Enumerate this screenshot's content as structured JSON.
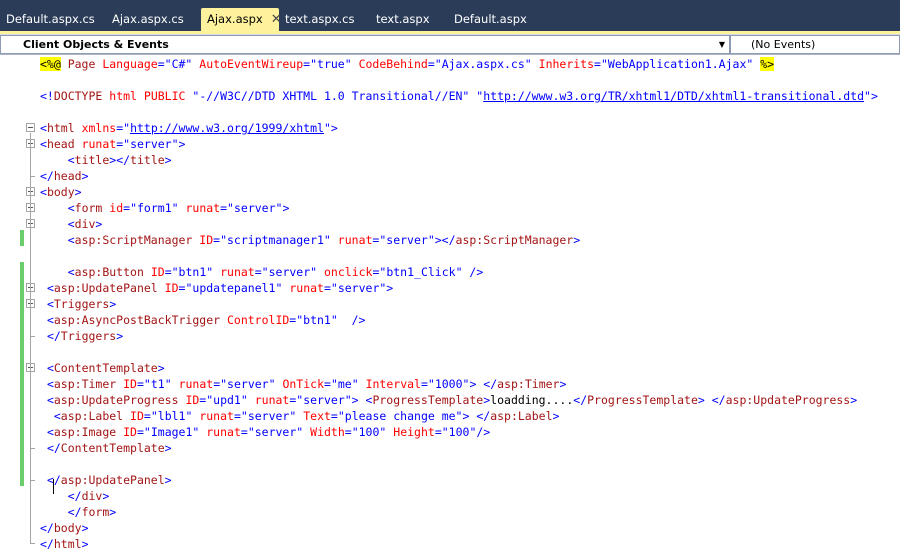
{
  "tabs": [
    {
      "label": "Default.aspx.cs",
      "active": false
    },
    {
      "label": "Ajax.aspx.cs",
      "active": false
    },
    {
      "label": "Ajax.aspx",
      "active": true
    },
    {
      "label": "text.aspx.cs",
      "active": false
    },
    {
      "label": "text.aspx",
      "active": false
    },
    {
      "label": "Default.aspx",
      "active": false
    }
  ],
  "navbar": {
    "objects_combo": "Client Objects & Events",
    "events_combo": "(No Events)"
  },
  "colors": {
    "tab_strip": "#2b3c59",
    "active_tab": "#fff29d",
    "change_bar": "#6ccd6c",
    "keyword": "#0000ff",
    "element": "#a31515",
    "attribute": "#ff0000",
    "directive_highlight": "#ffff00"
  },
  "code_lines": [
    [
      [
        "<%@",
        "hl-dir"
      ],
      [
        " Page ",
        "c-maroon"
      ],
      [
        "Language",
        "c-red"
      ],
      [
        "=",
        "c-blue"
      ],
      [
        "\"C#\"",
        "c-blue"
      ],
      [
        " ",
        ""
      ],
      [
        "AutoEventWireup",
        "c-red"
      ],
      [
        "=",
        "c-blue"
      ],
      [
        "\"true\"",
        "c-blue"
      ],
      [
        " ",
        ""
      ],
      [
        "CodeBehind",
        "c-red"
      ],
      [
        "=",
        "c-blue"
      ],
      [
        "\"Ajax.aspx.cs\"",
        "c-blue"
      ],
      [
        " ",
        ""
      ],
      [
        "Inherits",
        "c-red"
      ],
      [
        "=",
        "c-blue"
      ],
      [
        "\"WebApplication1.Ajax\"",
        "c-blue"
      ],
      [
        " ",
        ""
      ],
      [
        "%>",
        "hl-dir"
      ]
    ],
    [],
    [
      [
        "<!",
        "c-blue"
      ],
      [
        "DOCTYPE",
        "c-maroon"
      ],
      [
        " ",
        ""
      ],
      [
        "html",
        "c-red"
      ],
      [
        " ",
        ""
      ],
      [
        "PUBLIC",
        "c-red"
      ],
      [
        " ",
        ""
      ],
      [
        "\"-//W3C//DTD XHTML 1.0 Transitional//EN\"",
        "c-blue"
      ],
      [
        " ",
        ""
      ],
      [
        "\"",
        "c-blue"
      ],
      [
        "http://www.w3.org/TR/xhtml1/DTD/xhtml1-transitional.dtd",
        "c-link"
      ],
      [
        "\"",
        "c-blue"
      ],
      [
        ">",
        "c-blue"
      ]
    ],
    [],
    [
      [
        "<",
        "c-blue"
      ],
      [
        "html",
        "c-maroon"
      ],
      [
        " ",
        ""
      ],
      [
        "xmlns",
        "c-red"
      ],
      [
        "=",
        "c-blue"
      ],
      [
        "\"",
        "c-blue"
      ],
      [
        "http://www.w3.org/1999/xhtml",
        "c-link"
      ],
      [
        "\"",
        "c-blue"
      ],
      [
        ">",
        "c-blue"
      ]
    ],
    [
      [
        "<",
        "c-blue"
      ],
      [
        "head",
        "c-maroon"
      ],
      [
        " ",
        ""
      ],
      [
        "runat",
        "c-red"
      ],
      [
        "=",
        "c-blue"
      ],
      [
        "\"server\"",
        "c-blue"
      ],
      [
        ">",
        "c-blue"
      ]
    ],
    [
      [
        "    ",
        ""
      ],
      [
        "<",
        "c-blue"
      ],
      [
        "title",
        "c-maroon"
      ],
      [
        "></",
        "c-blue"
      ],
      [
        "title",
        "c-maroon"
      ],
      [
        ">",
        "c-blue"
      ]
    ],
    [
      [
        "</",
        "c-blue"
      ],
      [
        "head",
        "c-maroon"
      ],
      [
        ">",
        "c-blue"
      ]
    ],
    [
      [
        "<",
        "c-blue"
      ],
      [
        "body",
        "c-maroon"
      ],
      [
        ">",
        "c-blue"
      ]
    ],
    [
      [
        "    ",
        ""
      ],
      [
        "<",
        "c-blue"
      ],
      [
        "form",
        "c-maroon"
      ],
      [
        " ",
        ""
      ],
      [
        "id",
        "c-red"
      ],
      [
        "=",
        "c-blue"
      ],
      [
        "\"form1\"",
        "c-blue"
      ],
      [
        " ",
        ""
      ],
      [
        "runat",
        "c-red"
      ],
      [
        "=",
        "c-blue"
      ],
      [
        "\"server\"",
        "c-blue"
      ],
      [
        ">",
        "c-blue"
      ]
    ],
    [
      [
        "    ",
        ""
      ],
      [
        "<",
        "c-blue"
      ],
      [
        "div",
        "c-maroon"
      ],
      [
        ">",
        "c-blue"
      ]
    ],
    [
      [
        "    ",
        ""
      ],
      [
        "<",
        "c-blue"
      ],
      [
        "asp:ScriptManager",
        "c-maroon"
      ],
      [
        " ",
        ""
      ],
      [
        "ID",
        "c-red"
      ],
      [
        "=",
        "c-blue"
      ],
      [
        "\"scriptmanager1\"",
        "c-blue"
      ],
      [
        " ",
        ""
      ],
      [
        "runat",
        "c-red"
      ],
      [
        "=",
        "c-blue"
      ],
      [
        "\"server\"",
        "c-blue"
      ],
      [
        "></",
        "c-blue"
      ],
      [
        "asp:ScriptManager",
        "c-maroon"
      ],
      [
        ">",
        "c-blue"
      ]
    ],
    [],
    [
      [
        "    ",
        ""
      ],
      [
        "<",
        "c-blue"
      ],
      [
        "asp:Button",
        "c-maroon"
      ],
      [
        " ",
        ""
      ],
      [
        "ID",
        "c-red"
      ],
      [
        "=",
        "c-blue"
      ],
      [
        "\"btn1\"",
        "c-blue"
      ],
      [
        " ",
        ""
      ],
      [
        "runat",
        "c-red"
      ],
      [
        "=",
        "c-blue"
      ],
      [
        "\"server\"",
        "c-blue"
      ],
      [
        " ",
        ""
      ],
      [
        "onclick",
        "c-red"
      ],
      [
        "=",
        "c-blue"
      ],
      [
        "\"btn1_Click\"",
        "c-blue"
      ],
      [
        " />",
        "c-blue"
      ]
    ],
    [
      [
        " ",
        ""
      ],
      [
        "<",
        "c-blue"
      ],
      [
        "asp:UpdatePanel",
        "c-maroon"
      ],
      [
        " ",
        ""
      ],
      [
        "ID",
        "c-red"
      ],
      [
        "=",
        "c-blue"
      ],
      [
        "\"updatepanel1\"",
        "c-blue"
      ],
      [
        " ",
        ""
      ],
      [
        "runat",
        "c-red"
      ],
      [
        "=",
        "c-blue"
      ],
      [
        "\"server\"",
        "c-blue"
      ],
      [
        ">",
        "c-blue"
      ]
    ],
    [
      [
        " ",
        ""
      ],
      [
        "<",
        "c-blue"
      ],
      [
        "Triggers",
        "c-maroon"
      ],
      [
        ">",
        "c-blue"
      ]
    ],
    [
      [
        " ",
        ""
      ],
      [
        "<",
        "c-blue"
      ],
      [
        "asp:AsyncPostBackTrigger",
        "c-maroon"
      ],
      [
        " ",
        ""
      ],
      [
        "ControlID",
        "c-red"
      ],
      [
        "=",
        "c-blue"
      ],
      [
        "\"btn1\"",
        "c-blue"
      ],
      [
        "  />",
        "c-blue"
      ]
    ],
    [
      [
        " ",
        ""
      ],
      [
        "</",
        "c-blue"
      ],
      [
        "Triggers",
        "c-maroon"
      ],
      [
        ">",
        "c-blue"
      ]
    ],
    [],
    [
      [
        " ",
        ""
      ],
      [
        "<",
        "c-blue"
      ],
      [
        "ContentTemplate",
        "c-maroon"
      ],
      [
        ">",
        "c-blue"
      ]
    ],
    [
      [
        " ",
        ""
      ],
      [
        "<",
        "c-blue"
      ],
      [
        "asp:Timer",
        "c-maroon"
      ],
      [
        " ",
        ""
      ],
      [
        "ID",
        "c-red"
      ],
      [
        "=",
        "c-blue"
      ],
      [
        "\"t1\"",
        "c-blue"
      ],
      [
        " ",
        ""
      ],
      [
        "runat",
        "c-red"
      ],
      [
        "=",
        "c-blue"
      ],
      [
        "\"server\"",
        "c-blue"
      ],
      [
        " ",
        ""
      ],
      [
        "OnTick",
        "c-red"
      ],
      [
        "=",
        "c-blue"
      ],
      [
        "\"me\"",
        "c-blue"
      ],
      [
        " ",
        ""
      ],
      [
        "Interval",
        "c-red"
      ],
      [
        "=",
        "c-blue"
      ],
      [
        "\"1000\"",
        "c-blue"
      ],
      [
        "> </",
        "c-blue"
      ],
      [
        "asp:Timer",
        "c-maroon"
      ],
      [
        ">",
        "c-blue"
      ]
    ],
    [
      [
        " ",
        ""
      ],
      [
        "<",
        "c-blue"
      ],
      [
        "asp:UpdateProgress",
        "c-maroon"
      ],
      [
        " ",
        ""
      ],
      [
        "ID",
        "c-red"
      ],
      [
        "=",
        "c-blue"
      ],
      [
        "\"upd1\"",
        "c-blue"
      ],
      [
        " ",
        ""
      ],
      [
        "runat",
        "c-red"
      ],
      [
        "=",
        "c-blue"
      ],
      [
        "\"server\"",
        "c-blue"
      ],
      [
        "> <",
        "c-blue"
      ],
      [
        "ProgressTemplate",
        "c-maroon"
      ],
      [
        ">",
        "c-blue"
      ],
      [
        "loadding....",
        ""
      ],
      [
        "</",
        "c-blue"
      ],
      [
        "ProgressTemplate",
        "c-maroon"
      ],
      [
        "> </",
        "c-blue"
      ],
      [
        "asp:UpdateProgress",
        "c-maroon"
      ],
      [
        ">",
        "c-blue"
      ]
    ],
    [
      [
        "  ",
        ""
      ],
      [
        "<",
        "c-blue"
      ],
      [
        "asp:Label",
        "c-maroon"
      ],
      [
        " ",
        ""
      ],
      [
        "ID",
        "c-red"
      ],
      [
        "=",
        "c-blue"
      ],
      [
        "\"lbl1\"",
        "c-blue"
      ],
      [
        " ",
        ""
      ],
      [
        "runat",
        "c-red"
      ],
      [
        "=",
        "c-blue"
      ],
      [
        "\"server\"",
        "c-blue"
      ],
      [
        " ",
        ""
      ],
      [
        "Text",
        "c-red"
      ],
      [
        "=",
        "c-blue"
      ],
      [
        "\"please change me\"",
        "c-blue"
      ],
      [
        "> </",
        "c-blue"
      ],
      [
        "asp:Label",
        "c-maroon"
      ],
      [
        ">",
        "c-blue"
      ]
    ],
    [
      [
        " ",
        ""
      ],
      [
        "<",
        "c-blue"
      ],
      [
        "asp:Image",
        "c-maroon"
      ],
      [
        " ",
        ""
      ],
      [
        "ID",
        "c-red"
      ],
      [
        "=",
        "c-blue"
      ],
      [
        "\"Image1\"",
        "c-blue"
      ],
      [
        " ",
        ""
      ],
      [
        "runat",
        "c-red"
      ],
      [
        "=",
        "c-blue"
      ],
      [
        "\"server\"",
        "c-blue"
      ],
      [
        " ",
        ""
      ],
      [
        "Width",
        "c-red"
      ],
      [
        "=",
        "c-blue"
      ],
      [
        "\"100\"",
        "c-blue"
      ],
      [
        " ",
        ""
      ],
      [
        "Height",
        "c-red"
      ],
      [
        "=",
        "c-blue"
      ],
      [
        "\"100\"",
        "c-blue"
      ],
      [
        "/>",
        "c-blue"
      ]
    ],
    [
      [
        " ",
        ""
      ],
      [
        "</",
        "c-blue"
      ],
      [
        "ContentTemplate",
        "c-maroon"
      ],
      [
        ">",
        "c-blue"
      ]
    ],
    [],
    [
      [
        " ",
        ""
      ],
      [
        "</",
        "c-blue"
      ],
      [
        "asp:UpdatePanel",
        "c-maroon"
      ],
      [
        ">",
        "c-blue"
      ]
    ],
    [
      [
        "    ",
        ""
      ],
      [
        "</",
        "c-blue"
      ],
      [
        "div",
        "c-maroon"
      ],
      [
        ">",
        "c-blue"
      ]
    ],
    [
      [
        "    ",
        ""
      ],
      [
        "</",
        "c-blue"
      ],
      [
        "form",
        "c-maroon"
      ],
      [
        ">",
        "c-blue"
      ]
    ],
    [
      [
        "</",
        "c-blue"
      ],
      [
        "body",
        "c-maroon"
      ],
      [
        ">",
        "c-blue"
      ]
    ],
    [
      [
        "</",
        "c-blue"
      ],
      [
        "html",
        "c-maroon"
      ],
      [
        ">",
        "c-blue"
      ]
    ]
  ]
}
